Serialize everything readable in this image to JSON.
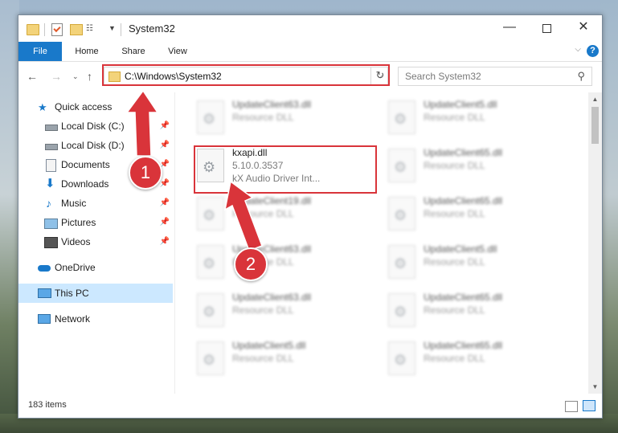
{
  "window": {
    "title": "System32"
  },
  "ribbon": {
    "tabs": [
      {
        "label": "File"
      },
      {
        "label": "Home"
      },
      {
        "label": "Share"
      },
      {
        "label": "View"
      }
    ],
    "help_label": "?"
  },
  "nav": {
    "address": "C:\\Windows\\System32",
    "search_placeholder": "Search System32"
  },
  "sidebar": {
    "items": [
      {
        "label": "Quick access"
      },
      {
        "label": "Local Disk (C:)"
      },
      {
        "label": "Local Disk (D:)"
      },
      {
        "label": "Documents"
      },
      {
        "label": "Downloads"
      },
      {
        "label": "Music"
      },
      {
        "label": "Pictures"
      },
      {
        "label": "Videos"
      },
      {
        "label": "OneDrive"
      },
      {
        "label": "This PC"
      },
      {
        "label": "Network"
      }
    ]
  },
  "files": {
    "highlighted": {
      "name": "kxapi.dll",
      "version": "5.10.0.3537",
      "description": "kX Audio Driver Int..."
    },
    "col1": [
      {
        "name": "UpdateClient63.dll",
        "type": "Resource DLL"
      },
      {
        "name": "UpdateClient19.dll",
        "type": "Resource DLL"
      },
      {
        "name": "UpdateClient63.dll",
        "type": "Resource DLL"
      },
      {
        "name": "UpdateClient63.dll",
        "type": "Resource DLL"
      },
      {
        "name": "UpdateClient5.dll",
        "type": "Resource DLL"
      }
    ],
    "col2": [
      {
        "name": "UpdateClient5.dll",
        "type": "Resource DLL"
      },
      {
        "name": "UpdateClient65.dll",
        "type": "Resource DLL"
      },
      {
        "name": "UpdateClient65.dll",
        "type": "Resource DLL"
      },
      {
        "name": "UpdateClient5.dll",
        "type": "Resource DLL"
      },
      {
        "name": "UpdateClient65.dll",
        "type": "Resource DLL"
      },
      {
        "name": "UpdateClient65.dll",
        "type": "Resource DLL"
      }
    ]
  },
  "status": {
    "item_count": "183 items"
  },
  "annotations": {
    "marker1": "1",
    "marker2": "2",
    "color": "#d9343a"
  },
  "colors": {
    "accent": "#1979ca",
    "selected": "#cce8ff"
  }
}
